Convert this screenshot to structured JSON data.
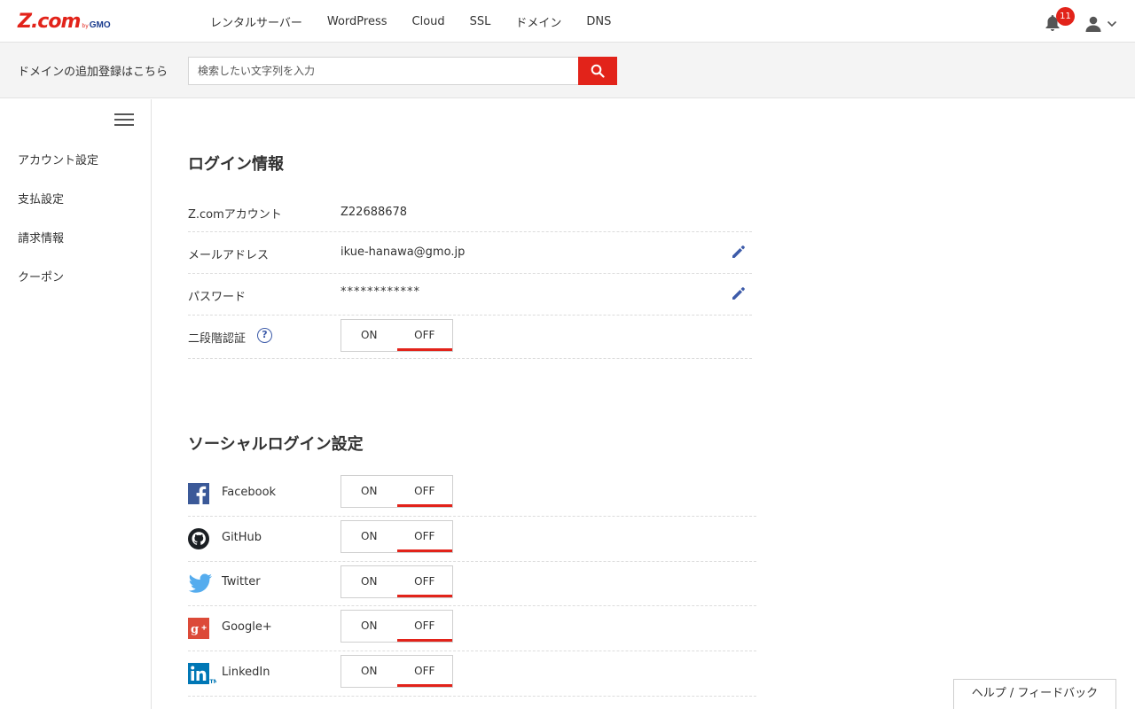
{
  "header": {
    "logo_main": "Z.com",
    "logo_by": "by",
    "logo_gmo": "GMO",
    "nav": [
      "レンタルサーバー",
      "WordPress",
      "Cloud",
      "SSL",
      "ドメイン",
      "DNS"
    ],
    "notification_count": "11",
    "accent_color": "#e2231a"
  },
  "search": {
    "label": "ドメインの追加登録はこちら",
    "placeholder": "検索したい文字列を入力"
  },
  "sidebar": {
    "items": [
      {
        "label": "アカウント設定"
      },
      {
        "label": "支払設定"
      },
      {
        "label": "請求情報"
      },
      {
        "label": "クーポン"
      }
    ]
  },
  "login": {
    "title": "ログイン情報",
    "account_label": "Z.comアカウント",
    "account_value": "Z22688678",
    "email_label": "メールアドレス",
    "email_value": "ikue-hanawa@gmo.jp",
    "password_label": "パスワード",
    "password_value": "************",
    "twofa_label": "二段階認証",
    "help_glyph": "?"
  },
  "toggle": {
    "on": "ON",
    "off": "OFF"
  },
  "social": {
    "title": "ソーシャルログイン設定",
    "items": [
      {
        "label": "Facebook",
        "icon": "facebook-icon"
      },
      {
        "label": "GitHub",
        "icon": "github-icon"
      },
      {
        "label": "Twitter",
        "icon": "twitter-icon"
      },
      {
        "label": "Google+",
        "icon": "google-plus-icon"
      },
      {
        "label": "LinkedIn",
        "icon": "linkedin-icon"
      }
    ]
  },
  "footer": {
    "help_feedback": "ヘルプ / フィードバック"
  }
}
